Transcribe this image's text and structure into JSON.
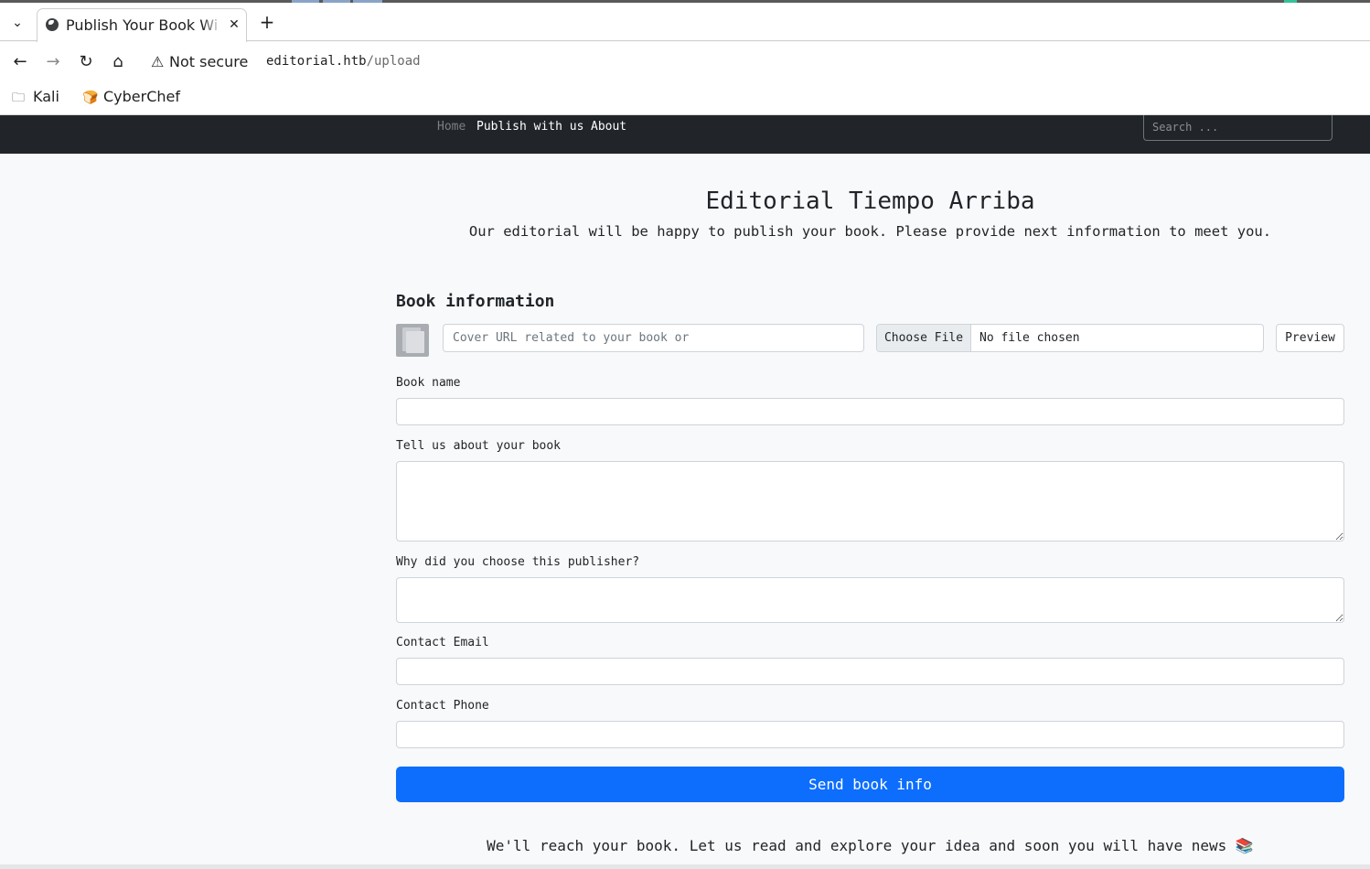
{
  "browser": {
    "tab_title": "Publish Your Book Wi",
    "tab_list_icon": "chevron-down",
    "close_icon": "x",
    "new_tab_icon": "+",
    "security_text": "Not secure",
    "url_host": "editorial.htb",
    "url_path": "/upload",
    "bookmarks": [
      {
        "label": "Kali",
        "icon": "folder-icon"
      },
      {
        "label": "CyberChef",
        "icon": "chef-hat-icon"
      }
    ]
  },
  "navbar": {
    "home": "Home",
    "publish": "Publish with us",
    "about": "About",
    "search_placeholder": "Search ..."
  },
  "header": {
    "title": "Editorial Tiempo Arriba",
    "lead": "Our editorial will be happy to publish your book. Please provide next information to meet you."
  },
  "form": {
    "section_title": "Book information",
    "cover_url_placeholder": "Cover URL related to your book or",
    "choose_file": "Choose File",
    "no_file": "No file chosen",
    "preview": "Preview",
    "book_name_label": "Book name",
    "about_book_label": "Tell us about your book",
    "why_publisher_label": "Why did you choose this publisher?",
    "email_label": "Contact Email",
    "phone_label": "Contact Phone",
    "submit": "Send book info"
  },
  "footer": {
    "note": "We'll reach your book. Let us read and explore your idea and soon you will have news 📚"
  },
  "colors": {
    "navbar_bg": "#212529",
    "primary": "#0d6efd",
    "page_bg": "#f8f9fa"
  }
}
